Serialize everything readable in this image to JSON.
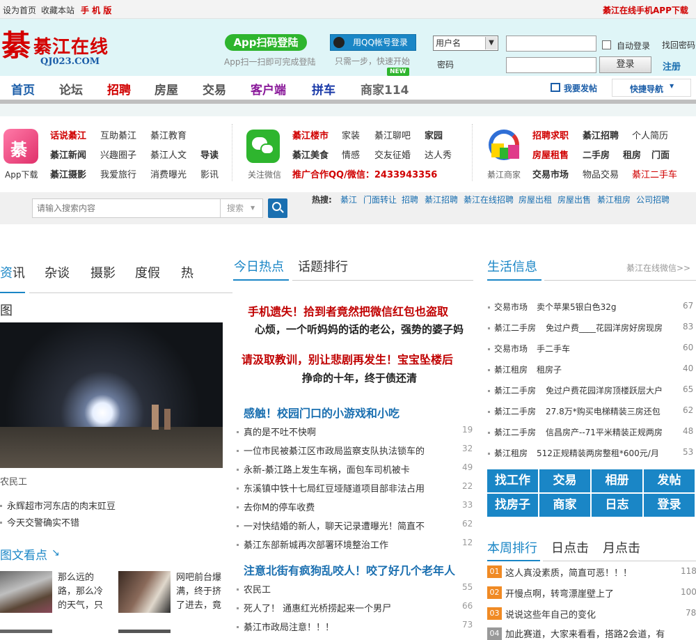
{
  "topbar": {
    "set_home": "设为首页",
    "bookmark": "收藏本站",
    "mobile": "手 机 版",
    "app_download": "綦江在线手机APP下载"
  },
  "brand": {
    "logo_main": "綦江在线",
    "logo_glyph": "綦",
    "logo_sub": "QJ023.COM"
  },
  "login": {
    "app_scan": "App扫码登陆",
    "app_scan_hint": "App扫一扫即可完成登陆",
    "qq_login": "用QQ帐号登录",
    "qq_hint": "只需一步，快速开始",
    "username_option": "用户名",
    "password_label": "密码",
    "auto_login": "自动登录",
    "forgot": "找回密码",
    "login_button": "登录",
    "register": "注册"
  },
  "nav": {
    "items": [
      "首页",
      "论坛",
      "招聘",
      "房屋",
      "交易",
      "客户端",
      "拼车",
      "商家114"
    ],
    "new_badge": "NEW",
    "post": "我要发帖",
    "quick_nav": "快捷导航"
  },
  "quicklinks": {
    "app_label": "App下载",
    "wechat_label": "关注微信",
    "merchant_label": "綦江商家",
    "col1": [
      [
        "话说綦江",
        "互助綦江",
        "綦江教育",
        ""
      ],
      [
        "綦江新闻",
        "兴趣圈子",
        "綦江人文",
        "导读"
      ],
      [
        "綦江摄影",
        "我爱旅行",
        "消费曝光",
        "影讯"
      ]
    ],
    "col2": [
      [
        "綦江楼市",
        "家装",
        "綦江聊吧",
        "家园"
      ],
      [
        "綦江美食",
        "情感",
        "交友征婚",
        "达人秀"
      ]
    ],
    "col2_promo": "推广合作QQ/微信：2433943356",
    "col3": [
      [
        "招聘求职",
        "綦江招聘",
        "个人简历"
      ],
      [
        "房屋租售",
        "二手房",
        "租房",
        "门面"
      ],
      [
        "交易市场",
        "物品交易",
        "綦江二手车"
      ]
    ]
  },
  "search": {
    "placeholder": "请输入搜索内容",
    "type": "搜索",
    "hot_label": "热搜:",
    "hot": [
      "綦江",
      "门面转让",
      "招聘",
      "綦江招聘",
      "綦江在线招聘",
      "房屋出租",
      "房屋出售",
      "綦江租房",
      "公司招聘"
    ]
  },
  "left": {
    "tabs": [
      "资讯",
      "杂谈",
      "摄影",
      "度假",
      "热"
    ],
    "tab_active_char": "资",
    "tab_rest": "讯",
    "section_pic": "图",
    "photo_caption": "农民工",
    "list": [
      "永辉超市河东店的肉末豇豆",
      "今天交警确实不错"
    ],
    "pic_news_title": "图文看点",
    "pic_news": [
      {
        "text": "那么远的路，那么冷的天气，只"
      },
      {
        "text": "网吧前台爆满，终于挤了进去，竟"
      }
    ]
  },
  "middle": {
    "tabs": [
      "今日热点",
      "话题排行"
    ],
    "headlines": [
      {
        "text": "手机遗失！拾到者竟然把微信红包也盗取",
        "style": "red"
      },
      {
        "text": "心烦，一个听妈妈的话的老公，强势的婆子妈",
        "style": "black"
      },
      {
        "text": "请汲取教训，别让悲剧再发生！宝宝坠楼后",
        "style": "red"
      },
      {
        "text": "挣命的十年，终于债还清",
        "style": "black"
      }
    ],
    "group1_title": "感触！校园门口的小游戏和小吃",
    "group1": [
      {
        "text": "真的是不吐不快啊",
        "count": "19"
      },
      {
        "text": "一位市民被綦江区市政局监察支队执法锁车的",
        "count": "32"
      },
      {
        "text": "永新-綦江路上发生车祸，面包车司机被卡",
        "count": "49"
      },
      {
        "text": "东溪镇中铁十七局红豆垭隧道项目部非法占用",
        "count": "22"
      },
      {
        "text": "去你M的停车收费",
        "count": "33"
      },
      {
        "text": "一对快结婚的新人，聊天记录遭曝光！简直不",
        "count": "62"
      },
      {
        "text": "綦江东部新城再次部署环境整治工作",
        "count": "12"
      }
    ],
    "group2_title": "注意北街有疯狗乱咬人！咬了好几个老年人",
    "group2": [
      {
        "text": "农民工",
        "count": "55"
      },
      {
        "text": "死人了！ 通惠红光桥捞起来一个男尸",
        "count": "66"
      },
      {
        "text": "綦江市政局注意！！！",
        "count": "73"
      }
    ]
  },
  "right": {
    "title": "生活信息",
    "wechat_link": "綦江在线微信>>",
    "life": [
      {
        "cat": "交易市场",
        "text": "卖个苹果5银白色32g",
        "count": "67"
      },
      {
        "cat": "綦江二手房",
        "text": "免过户费____花园洋房好房现房",
        "count": "83"
      },
      {
        "cat": "交易市场",
        "text": "手二手车",
        "count": "60"
      },
      {
        "cat": "綦江租房",
        "text": "租房子",
        "count": "40"
      },
      {
        "cat": "綦江二手房",
        "text": "免过户费花园洋房顶楼跃层大户",
        "count": "65"
      },
      {
        "cat": "綦江二手房",
        "text": "27.8万*购买电梯精装三房还包",
        "count": "62"
      },
      {
        "cat": "綦江二手房",
        "text": "信昌房产--71平米精装正规两房",
        "count": "48"
      },
      {
        "cat": "綦江租房",
        "text": "512正规精装两房整租*600元/月",
        "count": "53"
      }
    ],
    "buttons": [
      "找工作",
      "交易",
      "相册",
      "发帖",
      "找房子",
      "商家",
      "日志",
      "登录"
    ],
    "rank_tabs": [
      "本周排行",
      "日点击",
      "月点击"
    ],
    "ranks": [
      {
        "no": "01",
        "text": "这人真没素质，简直可恶！！！",
        "count": "118"
      },
      {
        "no": "02",
        "text": "开慢点啊，转弯漂崖壁上了",
        "count": "100"
      },
      {
        "no": "03",
        "text": "说说这些年自己的变化",
        "count": "78"
      },
      {
        "no": "04",
        "text": "加此赛道，大家来看看，搭路2会道，有",
        "count": ""
      }
    ]
  },
  "colors": {
    "accent": "#1a86c6",
    "red": "#c00000",
    "header_bg": "#dff5f7",
    "rank_orange": "#f08a24",
    "rank_grey": "#999999"
  }
}
